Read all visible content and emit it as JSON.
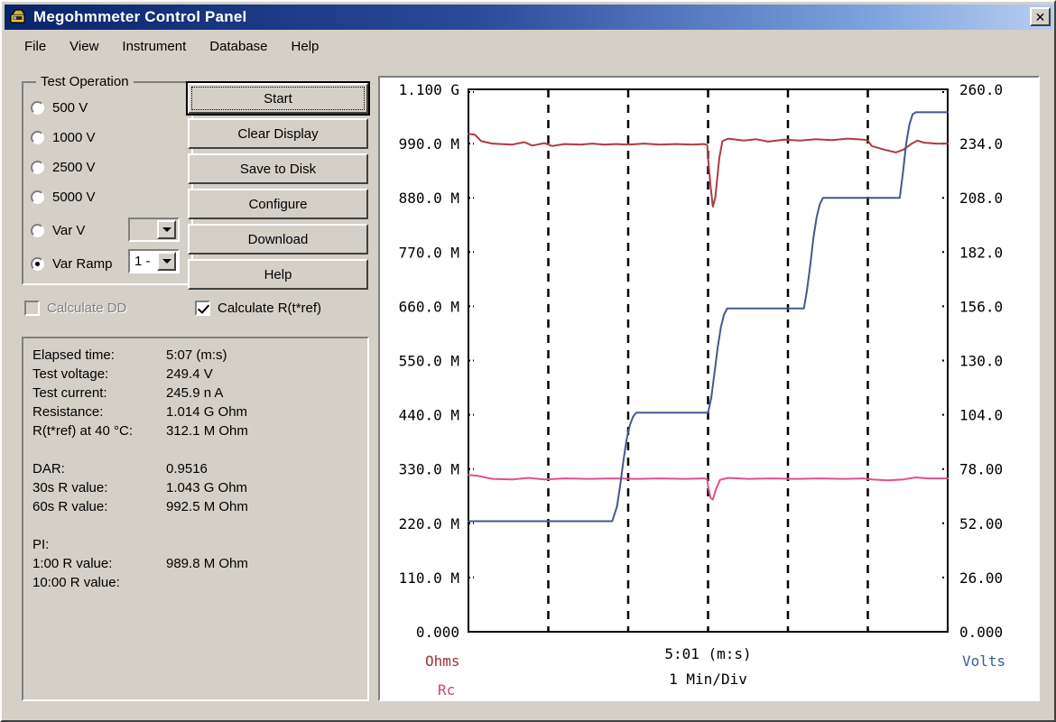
{
  "window": {
    "title": "Megohmmeter Control Panel",
    "icon": "app-icon",
    "close_label": "✕"
  },
  "menu": {
    "items": [
      {
        "label": "File"
      },
      {
        "label": "View"
      },
      {
        "label": "Instrument"
      },
      {
        "label": "Database"
      },
      {
        "label": "Help"
      }
    ]
  },
  "test_operation": {
    "title": "Test Operation",
    "options": [
      {
        "label": "500 V",
        "selected": false
      },
      {
        "label": "1000 V",
        "selected": false
      },
      {
        "label": "2500 V",
        "selected": false
      },
      {
        "label": "5000 V",
        "selected": false
      },
      {
        "label": "Var V",
        "selected": false
      },
      {
        "label": "Var Ramp",
        "selected": true
      }
    ],
    "var_v_combo": {
      "value": "",
      "enabled": false
    },
    "var_ramp_combo": {
      "value": "1 -",
      "enabled": true
    }
  },
  "buttons": [
    {
      "label": "Start",
      "default": true
    },
    {
      "label": "Clear Display",
      "default": false
    },
    {
      "label": "Save to Disk",
      "default": false
    },
    {
      "label": "Configure",
      "default": false
    },
    {
      "label": "Download",
      "default": false
    },
    {
      "label": "Help",
      "default": false
    }
  ],
  "checkboxes": [
    {
      "label": "Calculate DD",
      "checked": false,
      "enabled": false
    },
    {
      "label": "Calculate R(t*ref)",
      "checked": true,
      "enabled": true
    }
  ],
  "results": [
    {
      "label": "Elapsed time:",
      "value": "5:07 (m:s)"
    },
    {
      "label": "Test voltage:",
      "value": "249.4  V"
    },
    {
      "label": "Test current:",
      "value": "245.9 n A"
    },
    {
      "label": "Resistance:",
      "value": "1.014 G Ohm"
    },
    {
      "label": "R(t*ref) at 40 °C:",
      "value": "312.1 M Ohm"
    },
    {
      "label": "",
      "value": ""
    },
    {
      "label": "DAR:",
      "value": "0.9516"
    },
    {
      "label": "30s R value:",
      "value": "1.043 G Ohm"
    },
    {
      "label": "60s R value:",
      "value": "992.5 M Ohm"
    },
    {
      "label": "",
      "value": ""
    },
    {
      "label": "PI:",
      "value": ""
    },
    {
      "label": "1:00 R value:",
      "value": "989.8 M Ohm"
    },
    {
      "label": "10:00 R value:",
      "value": ""
    }
  ],
  "chart_data": {
    "type": "line",
    "title": "",
    "xlabel": "5:01 (m:s)",
    "xlabel2": "1 Min/Div",
    "x_ticks_per_div": "1 Min/Div",
    "grid": true,
    "grid_vertical_divisions": 6,
    "left_axis": {
      "label": "Ohms",
      "label2": "Rc",
      "color": "#a03038",
      "color2": "#d13f7a",
      "ticks": [
        "1.100 G",
        "990.0 M",
        "880.0 M",
        "770.0 M",
        "660.0 M",
        "550.0 M",
        "440.0 M",
        "330.0 M",
        "220.0 M",
        "110.0 M",
        "0.000"
      ],
      "values": [
        1100,
        990,
        880,
        770,
        660,
        550,
        440,
        330,
        220,
        110,
        0
      ],
      "unit": "M Ohm",
      "ylim": [
        0,
        1100
      ]
    },
    "right_axis": {
      "label": "Volts",
      "color": "#3a5a9a",
      "ticks": [
        "260.0",
        "234.0",
        "208.0",
        "182.0",
        "156.0",
        "130.0",
        "104.0",
        "78.00",
        "52.00",
        "26.00",
        "0.000"
      ],
      "values": [
        260,
        234,
        208,
        182,
        156,
        130,
        104,
        78,
        52,
        26,
        0
      ],
      "unit": "V",
      "ylim": [
        0,
        260
      ]
    },
    "x_range_minutes": [
      0,
      6
    ],
    "series": [
      {
        "name": "Ohms",
        "color": "#b03a42",
        "axis": "left",
        "unit": "M Ohm",
        "points": [
          [
            0.0,
            1010
          ],
          [
            0.08,
            1008
          ],
          [
            0.16,
            995
          ],
          [
            0.3,
            990
          ],
          [
            0.55,
            988
          ],
          [
            0.7,
            993
          ],
          [
            0.8,
            986
          ],
          [
            0.95,
            991
          ],
          [
            1.05,
            985
          ],
          [
            1.2,
            989
          ],
          [
            1.4,
            988
          ],
          [
            1.55,
            990
          ],
          [
            1.7,
            988
          ],
          [
            1.85,
            989
          ],
          [
            2.0,
            988
          ],
          [
            2.2,
            990
          ],
          [
            2.4,
            988
          ],
          [
            2.6,
            989
          ],
          [
            2.8,
            988
          ],
          [
            2.95,
            989
          ],
          [
            2.99,
            987
          ],
          [
            3.0,
            960
          ],
          [
            3.03,
            905
          ],
          [
            3.06,
            862
          ],
          [
            3.09,
            880
          ],
          [
            3.14,
            960
          ],
          [
            3.18,
            995
          ],
          [
            3.25,
            1000
          ],
          [
            3.45,
            996
          ],
          [
            3.6,
            999
          ],
          [
            3.75,
            994
          ],
          [
            3.95,
            998
          ],
          [
            4.15,
            996
          ],
          [
            4.35,
            999
          ],
          [
            4.55,
            997
          ],
          [
            4.75,
            1000
          ],
          [
            4.95,
            998
          ],
          [
            5.0,
            996
          ],
          [
            5.05,
            985
          ],
          [
            5.2,
            978
          ],
          [
            5.35,
            972
          ],
          [
            5.45,
            978
          ],
          [
            5.55,
            990
          ],
          [
            5.62,
            996
          ],
          [
            5.7,
            992
          ],
          [
            5.85,
            990
          ],
          [
            6.0,
            990
          ]
        ]
      },
      {
        "name": "Rc",
        "color": "#e0508f",
        "axis": "left",
        "unit": "M Ohm",
        "points": [
          [
            0.0,
            318
          ],
          [
            0.12,
            316
          ],
          [
            0.3,
            310
          ],
          [
            0.55,
            309
          ],
          [
            0.75,
            312
          ],
          [
            0.95,
            309
          ],
          [
            1.2,
            311
          ],
          [
            1.5,
            310
          ],
          [
            1.8,
            311
          ],
          [
            2.1,
            310
          ],
          [
            2.4,
            311
          ],
          [
            2.7,
            310
          ],
          [
            2.95,
            311
          ],
          [
            2.99,
            309
          ],
          [
            3.0,
            295
          ],
          [
            3.03,
            272
          ],
          [
            3.06,
            268
          ],
          [
            3.1,
            290
          ],
          [
            3.15,
            308
          ],
          [
            3.25,
            312
          ],
          [
            3.5,
            310
          ],
          [
            3.8,
            311
          ],
          [
            4.1,
            310
          ],
          [
            4.4,
            311
          ],
          [
            4.7,
            310
          ],
          [
            4.95,
            311
          ],
          [
            5.05,
            309
          ],
          [
            5.25,
            307
          ],
          [
            5.45,
            309
          ],
          [
            5.6,
            313
          ],
          [
            5.75,
            311
          ],
          [
            6.0,
            311
          ]
        ]
      },
      {
        "name": "Volts",
        "color": "#43588e",
        "axis": "right",
        "unit": "V",
        "step_levels_v": [
          53,
          105,
          155,
          208,
          249
        ],
        "points": [
          [
            0.0,
            53
          ],
          [
            1.8,
            53
          ],
          [
            1.86,
            60
          ],
          [
            1.9,
            70
          ],
          [
            1.94,
            82
          ],
          [
            1.98,
            92
          ],
          [
            2.02,
            99
          ],
          [
            2.06,
            103
          ],
          [
            2.1,
            105
          ],
          [
            3.0,
            105
          ],
          [
            3.04,
            112
          ],
          [
            3.08,
            124
          ],
          [
            3.12,
            136
          ],
          [
            3.16,
            146
          ],
          [
            3.2,
            152
          ],
          [
            3.24,
            155
          ],
          [
            4.2,
            155
          ],
          [
            4.24,
            164
          ],
          [
            4.28,
            176
          ],
          [
            4.32,
            189
          ],
          [
            4.36,
            199
          ],
          [
            4.4,
            205
          ],
          [
            4.44,
            208
          ],
          [
            5.4,
            208
          ],
          [
            5.44,
            220
          ],
          [
            5.48,
            234
          ],
          [
            5.52,
            243
          ],
          [
            5.56,
            248
          ],
          [
            5.6,
            249
          ],
          [
            6.0,
            249
          ]
        ]
      }
    ]
  }
}
